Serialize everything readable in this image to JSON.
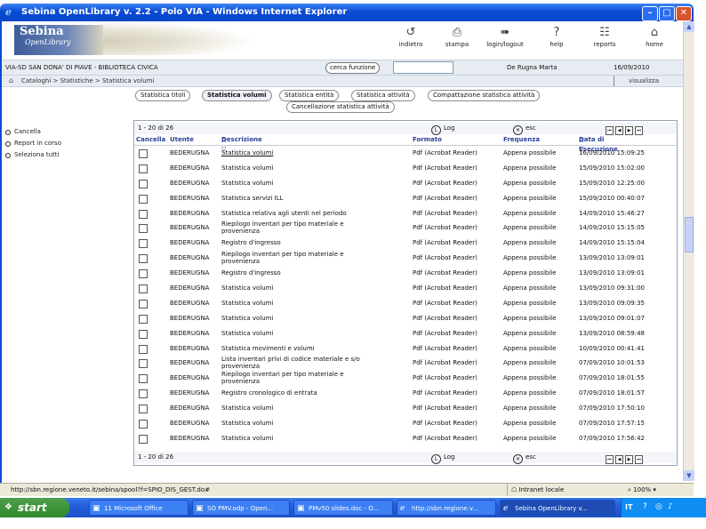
{
  "window": {
    "title": "Sebina OpenLibrary v. 2.2 - Polo VIA - Windows Internet Explorer"
  },
  "header": {
    "logo_line1": "Sebina",
    "logo_line2": "OpenLibrary",
    "nav": [
      {
        "label": "indietro",
        "icon": "back-icon"
      },
      {
        "label": "stampa",
        "icon": "print-icon"
      },
      {
        "label": "login/logout",
        "icon": "login-icon"
      },
      {
        "label": "help",
        "icon": "help-icon"
      },
      {
        "label": "reports",
        "icon": "reports-icon"
      },
      {
        "label": "home",
        "icon": "home-icon"
      }
    ]
  },
  "infobar": {
    "library": "VIA-SD SAN DONA' DI PIAVE - BIBLIOTECA CIVICA",
    "search_button": "cerca funzione",
    "search_value": "",
    "user": "De Rugna Marta",
    "date": "16/09/2010"
  },
  "breadcrumb": {
    "text": "Cataloghi > Statistiche > Statistica volumi",
    "visualize": "visualizza"
  },
  "tabs": [
    {
      "label": "Statistica titoli"
    },
    {
      "label": "Statistica volumi"
    },
    {
      "label": "Statistica entità"
    },
    {
      "label": "Statistica attività"
    },
    {
      "label": "Compattazione statistica attività"
    },
    {
      "label": "Cancellazione statistica attività"
    }
  ],
  "sidemenu": [
    "Cancella",
    "Report in corso",
    "Seleziona tutti"
  ],
  "table": {
    "range": "1 - 20 di 26",
    "log": "Log",
    "esc": "esc",
    "headers": {
      "cancella": "Cancella",
      "utente": "Utente",
      "descrizione": "Descrizione",
      "formato": "Formato",
      "frequenza": "Frequenza",
      "data": "Data di Esecuzione"
    },
    "rows": [
      {
        "utente": "BEDERUGNA",
        "desc": "Statistica volumi",
        "formato": "Pdf (Acrobat Reader)",
        "freq": "Appena possibile",
        "data": "16/09/2010 15:09:25"
      },
      {
        "utente": "BEDERUGNA",
        "desc": "Statistica volumi",
        "formato": "Pdf (Acrobat Reader)",
        "freq": "Appena possibile",
        "data": "15/09/2010 15:02:00"
      },
      {
        "utente": "BEDERUGNA",
        "desc": "Statistica volumi",
        "formato": "Pdf (Acrobat Reader)",
        "freq": "Appena possibile",
        "data": "15/09/2010 12:25:00"
      },
      {
        "utente": "BEDERUGNA",
        "desc": "Statistica servizi ILL",
        "formato": "Pdf (Acrobat Reader)",
        "freq": "Appena possibile",
        "data": "15/09/2010 00:40:07"
      },
      {
        "utente": "BEDERUGNA",
        "desc": "Statistica relativa agli utenti nel periodo",
        "formato": "Pdf (Acrobat Reader)",
        "freq": "Appena possibile",
        "data": "14/09/2010 15:46:27"
      },
      {
        "utente": "BEDERUGNA",
        "desc": "Riepilogo inventari per tipo materiale e provenienza",
        "formato": "Pdf (Acrobat Reader)",
        "freq": "Appena possibile",
        "data": "14/09/2010 15:15:05"
      },
      {
        "utente": "BEDERUGNA",
        "desc": "Registro d'ingresso",
        "formato": "Pdf (Acrobat Reader)",
        "freq": "Appena possibile",
        "data": "14/09/2010 15:15:04"
      },
      {
        "utente": "BEDERUGNA",
        "desc": "Riepilogo inventari per tipo materiale e provenienza",
        "formato": "Pdf (Acrobat Reader)",
        "freq": "Appena possibile",
        "data": "13/09/2010 13:09:01"
      },
      {
        "utente": "BEDERUGNA",
        "desc": "Registro d'ingresso",
        "formato": "Pdf (Acrobat Reader)",
        "freq": "Appena possibile",
        "data": "13/09/2010 13:09:01"
      },
      {
        "utente": "BEDERUGNA",
        "desc": "Statistica volumi",
        "formato": "Pdf (Acrobat Reader)",
        "freq": "Appena possibile",
        "data": "13/09/2010 09:31:00"
      },
      {
        "utente": "BEDERUGNA",
        "desc": "Statistica volumi",
        "formato": "Pdf (Acrobat Reader)",
        "freq": "Appena possibile",
        "data": "13/09/2010 09:09:35"
      },
      {
        "utente": "BEDERUGNA",
        "desc": "Statistica volumi",
        "formato": "Pdf (Acrobat Reader)",
        "freq": "Appena possibile",
        "data": "13/09/2010 09:01:07"
      },
      {
        "utente": "BEDERUGNA",
        "desc": "Statistica volumi",
        "formato": "Pdf (Acrobat Reader)",
        "freq": "Appena possibile",
        "data": "13/09/2010 08:59:48"
      },
      {
        "utente": "BEDERUGNA",
        "desc": "Statistica movimenti e volumi",
        "formato": "Pdf (Acrobat Reader)",
        "freq": "Appena possibile",
        "data": "10/09/2010 00:41:41"
      },
      {
        "utente": "BEDERUGNA",
        "desc": "Lista inventari privi di codice materiale e s/o provenienza",
        "formato": "Pdf (Acrobat Reader)",
        "freq": "Appena possibile",
        "data": "07/09/2010 10:01:53"
      },
      {
        "utente": "BEDERUGNA",
        "desc": "Riepilogo inventari per tipo materiale e provenienza",
        "formato": "Pdf (Acrobat Reader)",
        "freq": "Appena possibile",
        "data": "07/09/2010 18:01:55"
      },
      {
        "utente": "BEDERUGNA",
        "desc": "Registro cronologico di entrata",
        "formato": "Pdf (Acrobat Reader)",
        "freq": "Appena possibile",
        "data": "07/09/2010 18:01:57"
      },
      {
        "utente": "BEDERUGNA",
        "desc": "Statistica volumi",
        "formato": "Pdf (Acrobat Reader)",
        "freq": "Appena possibile",
        "data": "07/09/2010 17:50:10"
      },
      {
        "utente": "BEDERUGNA",
        "desc": "Statistica volumi",
        "formato": "Pdf (Acrobat Reader)",
        "freq": "Appena possibile",
        "data": "07/09/2010 17:57:15"
      },
      {
        "utente": "BEDERUGNA",
        "desc": "Statistica volumi",
        "formato": "Pdf (Acrobat Reader)",
        "freq": "Appena possibile",
        "data": "07/09/2010 17:56:42"
      }
    ]
  },
  "statusbar": {
    "url": "http://sbn.regione.veneto.it/sebina/spool?f=SPIO_DIS_GEST.do#",
    "zone": "Intranet locale",
    "zoom": "100%"
  },
  "taskbar": {
    "start": "start",
    "tasks": [
      "11 Microsoft Office",
      "SO PMV.odp - Open...",
      "PMv50 slides.doc - O...",
      "http://sbn.regione.v...",
      "Sebina OpenLibrary v..."
    ],
    "lang": "IT"
  },
  "colors": {
    "header_blue": "#2c3f99",
    "title_blue": "#0a4bd4",
    "taskbar_blue": "#245edb",
    "start_green": "#2f8a2b"
  }
}
